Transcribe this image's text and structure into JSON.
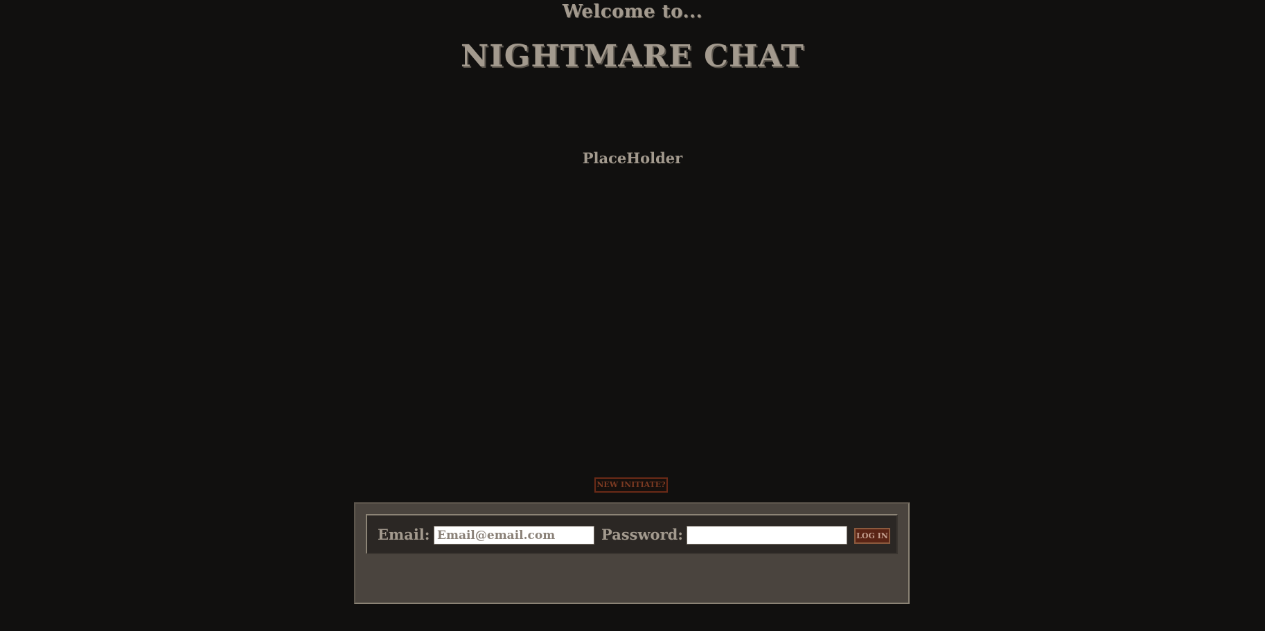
{
  "header": {
    "welcome": "Welcome to...",
    "title": "NIGHTMARE CHAT"
  },
  "main": {
    "placeholder": "PlaceHolder"
  },
  "signup": {
    "label": "NEW INITIATE?"
  },
  "login": {
    "email_label": "Email:",
    "email_placeholder": "Email@email.com",
    "email_value": "",
    "password_label": "Password:",
    "password_value": "",
    "submit_label": "LOG IN"
  },
  "colors": {
    "background": "#11100f",
    "text": "#a39a8e",
    "accent": "#6b2a17",
    "panel": "#4a443e",
    "login_bar": "#2b2724"
  }
}
